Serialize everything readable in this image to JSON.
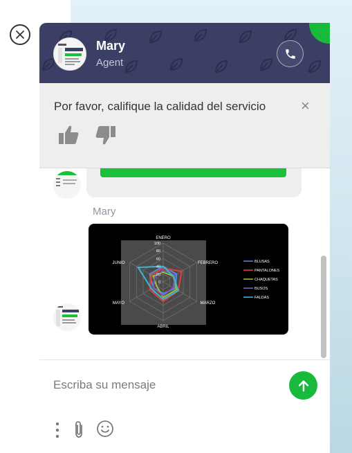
{
  "header": {
    "agent_name": "Mary",
    "agent_role": "Agent",
    "avatar": "agent-avatar-screenshot",
    "call_icon": "phone-icon",
    "brand_color": "#3c3f65",
    "accent_color": "#19b93b"
  },
  "close_icon": "close-circle-icon",
  "rating": {
    "prompt": "Por favor, califique la calidad del servicio",
    "close_glyph": "×",
    "thumbs_up_icon": "thumbs-up-icon",
    "thumbs_down_icon": "thumbs-down-icon"
  },
  "messages": {
    "sender": "Mary"
  },
  "chart_data": {
    "type": "radar",
    "title": "",
    "axes": [
      "ENERO",
      "FEBRERO",
      "MARZO",
      "ABRIL",
      "MAYO",
      "JUNIO"
    ],
    "rlim": [
      0,
      100
    ],
    "ticks": [
      "100",
      "80",
      "60",
      "40",
      "20",
      "0"
    ],
    "legend_position": "right",
    "series": [
      {
        "name": "BLUSAS",
        "color": "#5b8bd6",
        "values": [
          40,
          40,
          35,
          30,
          30,
          40
        ]
      },
      {
        "name": "PANTALONES",
        "color": "#e0413a",
        "values": [
          35,
          55,
          45,
          50,
          40,
          35
        ]
      },
      {
        "name": "CHAQUETAS",
        "color": "#9bc23a",
        "values": [
          25,
          30,
          40,
          40,
          20,
          30
        ]
      },
      {
        "name": "BUSOS",
        "color": "#7a5fb0",
        "values": [
          30,
          35,
          30,
          35,
          30,
          25
        ]
      },
      {
        "name": "FALDAS",
        "color": "#3fb5d6",
        "values": [
          40,
          30,
          45,
          45,
          35,
          75
        ]
      }
    ]
  },
  "composer": {
    "placeholder": "Escriba su mensaje",
    "send_icon": "arrow-up-icon",
    "more_icon": "more-vertical-icon",
    "attach_icon": "paperclip-icon",
    "emoji_icon": "smiley-icon"
  }
}
